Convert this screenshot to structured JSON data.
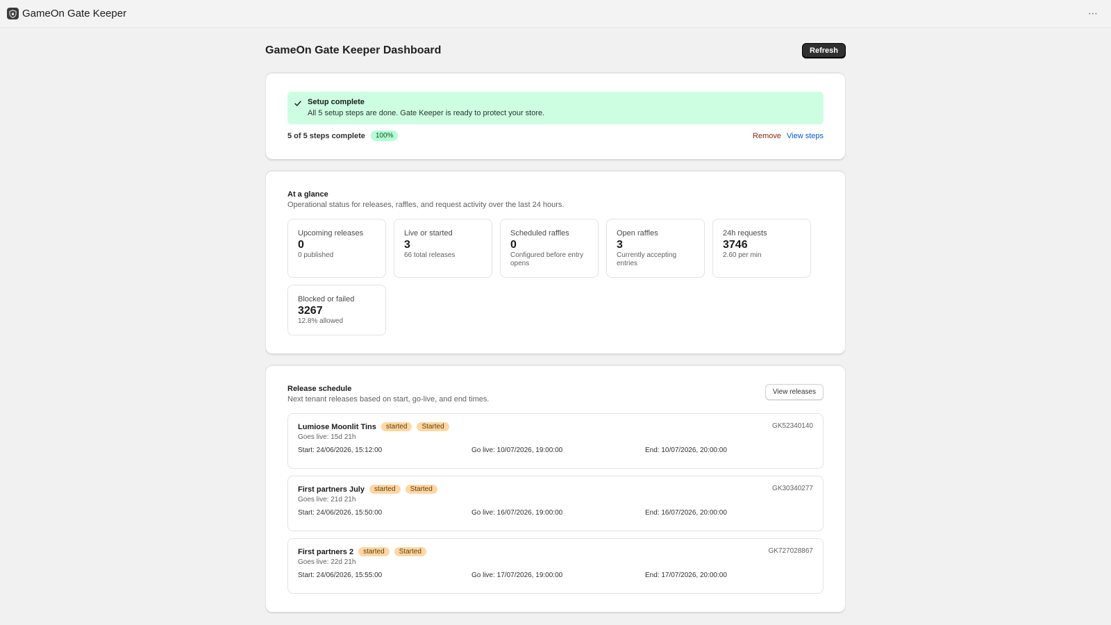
{
  "app": {
    "title": "GameOn Gate Keeper",
    "more_label": "⋯"
  },
  "page": {
    "title": "GameOn Gate Keeper Dashboard",
    "refresh_label": "Refresh"
  },
  "setup": {
    "banner_title": "Setup complete",
    "banner_text": "All 5 setup steps are done. Gate Keeper is ready to protect your store.",
    "steps_text": "5 of 5 steps complete",
    "percent_label": "100%",
    "progress_fraction": 1.0,
    "remove_label": "Remove",
    "view_steps_label": "View steps"
  },
  "glance": {
    "title": "At a glance",
    "subtitle": "Operational status for releases, raffles, and request activity over the last 24 hours.",
    "stats": [
      {
        "label": "Upcoming releases",
        "value": "0",
        "sub": "0 published"
      },
      {
        "label": "Live or started",
        "value": "3",
        "sub": "66 total releases"
      },
      {
        "label": "Scheduled raffles",
        "value": "0",
        "sub": "Configured before entry opens"
      },
      {
        "label": "Open raffles",
        "value": "3",
        "sub": "Currently accepting entries"
      },
      {
        "label": "24h requests",
        "value": "3746",
        "sub": "2.60 per min"
      },
      {
        "label": "Blocked or failed",
        "value": "3267",
        "sub": "12.8% allowed"
      }
    ]
  },
  "releases": {
    "title": "Release schedule",
    "subtitle": "Next tenant releases based on start, go-live, and end times.",
    "view_label": "View releases",
    "items": [
      {
        "name": "Lumiose Moonlit Tins",
        "tag1": "started",
        "tag2": "Started",
        "id": "GK52340140",
        "golive": "Goes live: 15d 21h",
        "start": "Start: 24/06/2026, 15:12:00",
        "go": "Go live: 10/07/2026, 19:00:00",
        "end": "End: 10/07/2026, 20:00:00"
      },
      {
        "name": "First partners July",
        "tag1": "started",
        "tag2": "Started",
        "id": "GK30340277",
        "golive": "Goes live: 21d 21h",
        "start": "Start: 24/06/2026, 15:50:00",
        "go": "Go live: 16/07/2026, 19:00:00",
        "end": "End: 16/07/2026, 20:00:00"
      },
      {
        "name": "First partners 2",
        "tag1": "started",
        "tag2": "Started",
        "id": "GK727028867",
        "golive": "Goes live: 22d 21h",
        "start": "Start: 24/06/2026, 15:55:00",
        "go": "Go live: 17/07/2026, 19:00:00",
        "end": "End: 17/07/2026, 20:00:00"
      }
    ]
  },
  "colors": {
    "success_banner": "#cdfee1",
    "tag_orange": "#ffd6a4",
    "link_blue": "#005bd3",
    "critical_red": "#8e1f0b"
  }
}
